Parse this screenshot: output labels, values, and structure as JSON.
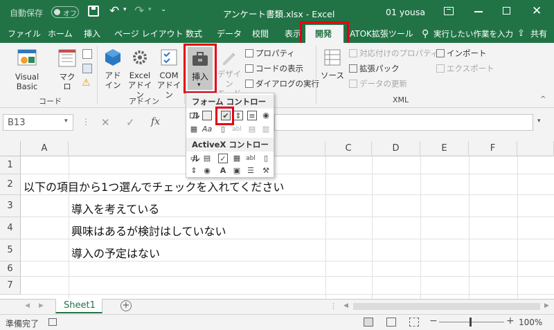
{
  "titlebar": {
    "autosave_label": "自動保存",
    "autosave_state": "オフ",
    "title": "アンケート書類.xlsx  -  Excel",
    "user": "01 yousa"
  },
  "tabs": [
    "ファイル",
    "ホーム",
    "挿入",
    "ページ レイアウト",
    "数式",
    "データ",
    "校閲",
    "表示",
    "開発",
    "ATOK拡張ツール"
  ],
  "tell_me": "実行したい作業を入力",
  "share": "共有",
  "ribbon": {
    "code_group": {
      "label": "コード",
      "visual_basic": "Visual Basic",
      "macro": "マクロ"
    },
    "addin_group": {
      "label": "アドイン",
      "addin": "アド\nイン",
      "excel_addin": "Excel\nアドイン",
      "com_addin": "COM\nアドイン"
    },
    "controls_group": {
      "insert": "挿入",
      "design_mode": "デザイン\nモード",
      "properties": "プロパティ",
      "view_code": "コードの表示",
      "run_dialog": "ダイアログの実行"
    },
    "xml_group": {
      "label": "XML",
      "source": "ソース",
      "map_properties": "対応付けのプロパティ",
      "expansion_packs": "拡張パック",
      "refresh_data": "データの更新",
      "import": "インポート",
      "export": "エクスポート"
    }
  },
  "namebox": "B13",
  "formula_icons": {
    "cancel": "✕",
    "enter": "✓",
    "fx": "fx"
  },
  "columns": [
    "A",
    "C",
    "D",
    "E",
    "F"
  ],
  "rows": [
    "1",
    "2",
    "3",
    "4",
    "5",
    "6",
    "7"
  ],
  "cells": {
    "a2": "以下の項目から1つ選んでチェックを入れてください",
    "b3": "導入を考えている",
    "b4": "興味はあるが検討はしていない",
    "b5": "導入の予定はない"
  },
  "dropdown": {
    "form_header": "フォーム コントロール",
    "activex_header": "ActiveX コントロール"
  },
  "sheet_tab": "Sheet1",
  "status": {
    "ready": "準備完了",
    "zoom": "100%"
  },
  "colors": {
    "excel_green": "#217346",
    "highlight_red": "#e60012"
  }
}
